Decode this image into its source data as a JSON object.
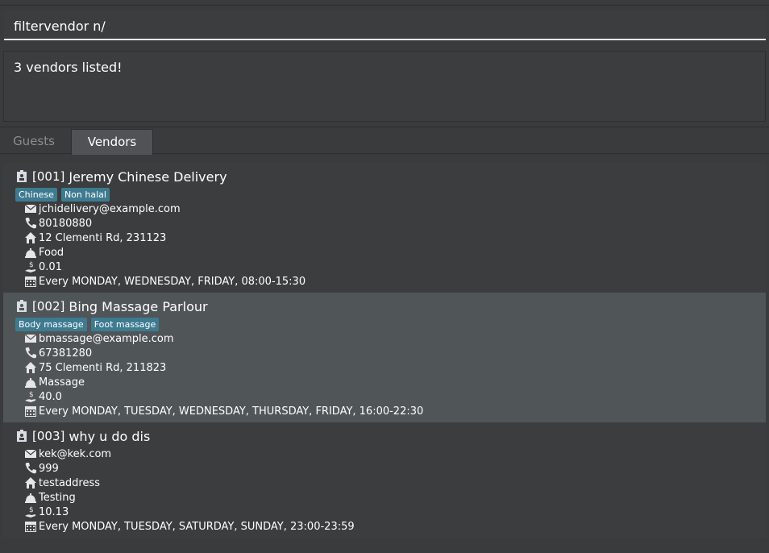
{
  "command_box": {
    "value": "filtervendor n/"
  },
  "result_display": {
    "text": "3 vendors listed!"
  },
  "tabs": [
    {
      "label": "Guests",
      "selected": false
    },
    {
      "label": "Vendors",
      "selected": true
    }
  ],
  "colors": {
    "tag_bg": "#3e7b91",
    "selected_card_bg": "#505558",
    "card_bg": "#3c3d3f"
  },
  "vendors": [
    {
      "index": "[001]",
      "name": "Jeremy Chinese Delivery",
      "tags": [
        "Chinese",
        "Non halal"
      ],
      "email": "jchidelivery@example.com",
      "phone": "80180880",
      "address": "12 Clementi Rd, 231123",
      "service": "Food",
      "cost": "0.01",
      "operating_hours": "Every MONDAY, WEDNESDAY, FRIDAY,  08:00-15:30"
    },
    {
      "index": "[002]",
      "name": "Bing Massage Parlour",
      "tags": [
        "Body massage",
        "Foot massage"
      ],
      "email": "bmassage@example.com",
      "phone": "67381280",
      "address": "75 Clementi Rd, 211823",
      "service": "Massage",
      "cost": "40.0",
      "operating_hours": "Every MONDAY, TUESDAY, WEDNESDAY, THURSDAY, FRIDAY,  16:00-22:30"
    },
    {
      "index": "[003]",
      "name": "why u do dis",
      "tags": [],
      "email": "kek@kek.com",
      "phone": "999",
      "address": "testaddress",
      "service": "Testing",
      "cost": "10.13",
      "operating_hours": "Every MONDAY, TUESDAY, SATURDAY, SUNDAY,  23:00-23:59"
    }
  ]
}
